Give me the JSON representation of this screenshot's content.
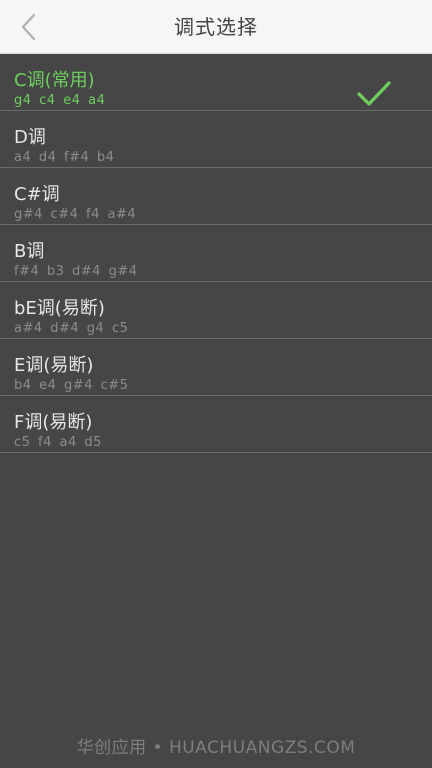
{
  "header": {
    "title": "调式选择",
    "back_icon": "chevron-left-icon"
  },
  "colors": {
    "selected": "#6fcf5e",
    "background": "#464646",
    "header_bg": "#f6f6f6"
  },
  "tunings": [
    {
      "name": "C调(常用)",
      "notes": "g4 c4 e4 a4",
      "selected": true
    },
    {
      "name": "D调",
      "notes": "a4 d4 f#4 b4",
      "selected": false
    },
    {
      "name": "C#调",
      "notes": "g#4 c#4 f4 a#4",
      "selected": false
    },
    {
      "name": "B调",
      "notes": "f#4 b3 d#4 g#4",
      "selected": false
    },
    {
      "name": "bE调(易断)",
      "notes": "a#4 d#4 g4 c5",
      "selected": false
    },
    {
      "name": "E调(易断)",
      "notes": "b4 e4 g#4 c#5",
      "selected": false
    },
    {
      "name": "F调(易断)",
      "notes": "c5 f4 a4 d5",
      "selected": false
    }
  ],
  "footer": {
    "watermark": "华创应用 • HUACHUANGZS.COM"
  }
}
